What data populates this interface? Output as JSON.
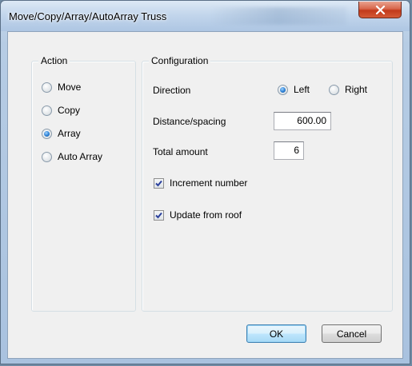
{
  "window": {
    "title": "Move/Copy/Array/AutoArray Truss",
    "close_icon": "close-icon"
  },
  "action_group": {
    "title": "Action",
    "options": [
      {
        "label": "Move",
        "checked": false
      },
      {
        "label": "Copy",
        "checked": false
      },
      {
        "label": "Array",
        "checked": true
      },
      {
        "label": "Auto Array",
        "checked": false
      }
    ]
  },
  "configuration_group": {
    "title": "Configuration",
    "direction": {
      "label": "Direction",
      "left_label": "Left",
      "right_label": "Right",
      "selected": "Left"
    },
    "distance": {
      "label": "Distance/spacing",
      "value": "600.00"
    },
    "total_amount": {
      "label": "Total amount",
      "value": "6"
    },
    "increment_number": {
      "label": "Increment number",
      "checked": true
    },
    "update_from_roof": {
      "label": "Update from roof",
      "checked": true
    }
  },
  "buttons": {
    "ok_label": "OK",
    "cancel_label": "Cancel"
  },
  "colors": {
    "accent": "#2b7fd4",
    "close_button": "#c23a1c",
    "title_bar": "#c3d6ec"
  }
}
